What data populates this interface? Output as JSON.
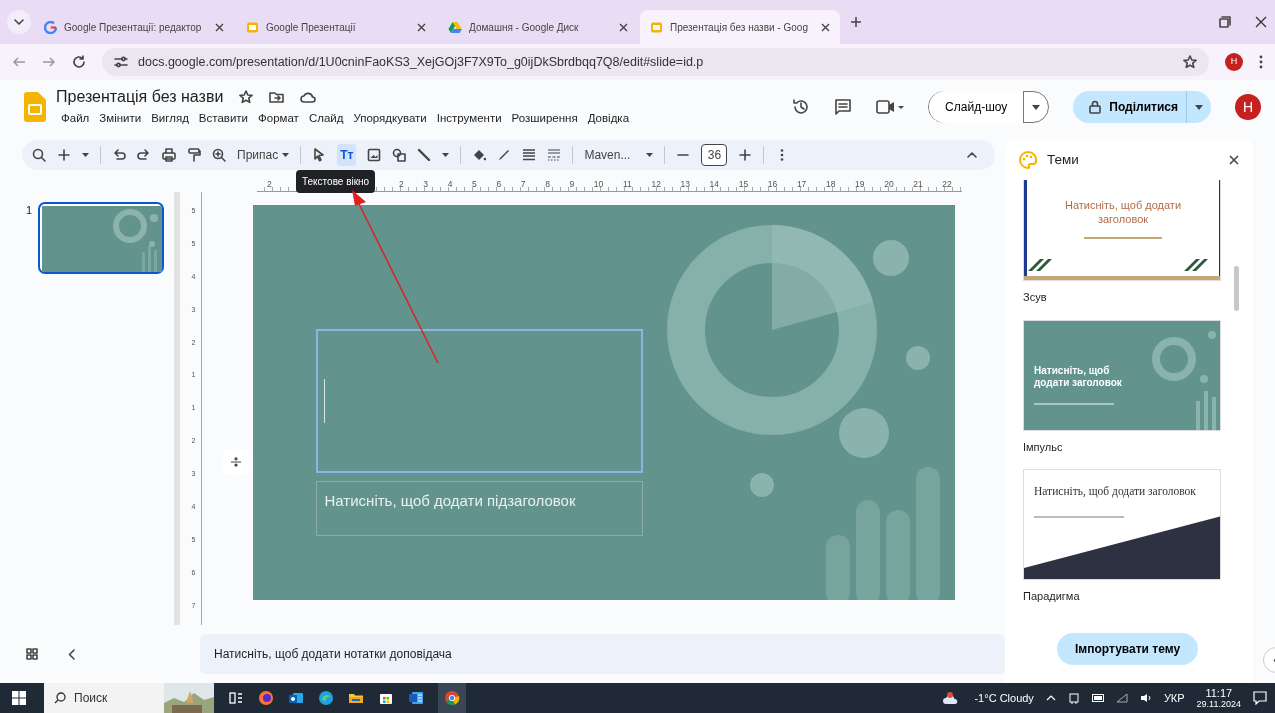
{
  "browser": {
    "tabs": [
      {
        "kind": "google",
        "title": "Google Презентації: редактор",
        "selected": false
      },
      {
        "kind": "slides",
        "title": "Google Презентації",
        "selected": false
      },
      {
        "kind": "drive",
        "title": "Домашня - Google Диск",
        "selected": false
      },
      {
        "kind": "slides",
        "title": "Презентація без назви - Goog",
        "selected": true
      }
    ],
    "url": "docs.google.com/presentation/d/1U0cninFaoKS3_XejGOj3F7X9To_g0ijDkSbrdbqq7Q8/edit#slide=id.p",
    "profile": "Н"
  },
  "document": {
    "title": "Презентація без назви",
    "menu": [
      "Файл",
      "Змінити",
      "Вигляд",
      "Вставити",
      "Формат",
      "Слайд",
      "Упорядкувати",
      "Інструменти",
      "Розширення",
      "Довідка"
    ]
  },
  "header": {
    "slideshow": "Слайд-шоу",
    "share": "Поділитися",
    "avatar": "Н"
  },
  "toolbar": {
    "zoom": "Припас",
    "textbox_tool": {
      "label": "Tт",
      "selected": true
    },
    "font": "Maven...",
    "font_size": "36",
    "tooltip": "Текстове вікно"
  },
  "ruler": {
    "horizontal": [
      "2",
      "2",
      "3",
      "4",
      "5",
      "6",
      "7",
      "8",
      "9",
      "10",
      "11",
      "12",
      "13",
      "14",
      "15",
      "16",
      "17",
      "18",
      "19",
      "20",
      "21",
      "22"
    ],
    "vertical": [
      "5",
      "5",
      "4",
      "3",
      "2",
      "1",
      "1",
      "2",
      "3",
      "4",
      "5",
      "6",
      "7"
    ]
  },
  "filmstrip": {
    "slides": [
      {
        "number": "1",
        "selected": true
      }
    ]
  },
  "slide": {
    "title_selected": true,
    "subtitle_prompt": "Натисніть, щоб додати підзаголовок"
  },
  "themes": {
    "title": "Теми",
    "items": [
      {
        "kind": "shift",
        "name": "Зсув",
        "preview_title": "Натисніть, щоб додати заголовок"
      },
      {
        "kind": "pulse",
        "name": "Імпульс",
        "preview_title": "Натисніть, щоб додати заголовок"
      },
      {
        "kind": "paradigm",
        "name": "Парадигма",
        "preview_title": "Натисніть, щоб додати заголовок"
      }
    ],
    "import_button": "Імпортувати тему"
  },
  "notes": {
    "prompt": "Натисніть, щоб додати нотатки доповідача"
  },
  "taskbar": {
    "search": "Поиск",
    "weather": "-1°C  Cloudy",
    "language": "УКР",
    "time": "11:17",
    "date": "29.11.2024"
  }
}
